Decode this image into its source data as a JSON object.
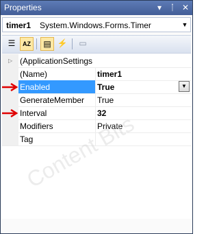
{
  "window": {
    "title": "Properties"
  },
  "title_icons": {
    "dropdown": "▾",
    "pin": "ᛙ",
    "close": "✕"
  },
  "object_selector": {
    "name": "timer1",
    "type": "System.Windows.Forms.Timer",
    "dropdown": "▼"
  },
  "toolbar": {
    "categorized": "☰",
    "alphabetical": "AZ",
    "properties": "▤",
    "events": "⚡",
    "property_pages": "▭"
  },
  "properties": [
    {
      "name": "(ApplicationSettings",
      "value": "",
      "expandable": true,
      "expand_glyph": "▷"
    },
    {
      "name": "(Name)",
      "value": "timer1",
      "value_bold": true
    },
    {
      "name": "Enabled",
      "value": "True",
      "value_bold": true,
      "selected": true,
      "has_dropdown": true,
      "dropdown_glyph": "▼"
    },
    {
      "name": "GenerateMember",
      "value": "True"
    },
    {
      "name": "Interval",
      "value": "32",
      "value_bold": true
    },
    {
      "name": "Modifiers",
      "value": "Private"
    },
    {
      "name": "Tag",
      "value": ""
    }
  ],
  "watermark": "Content Bits",
  "colors": {
    "title_bar": "#4a66a0",
    "selection": "#3399ff",
    "annotation_arrow": "#e00000"
  }
}
